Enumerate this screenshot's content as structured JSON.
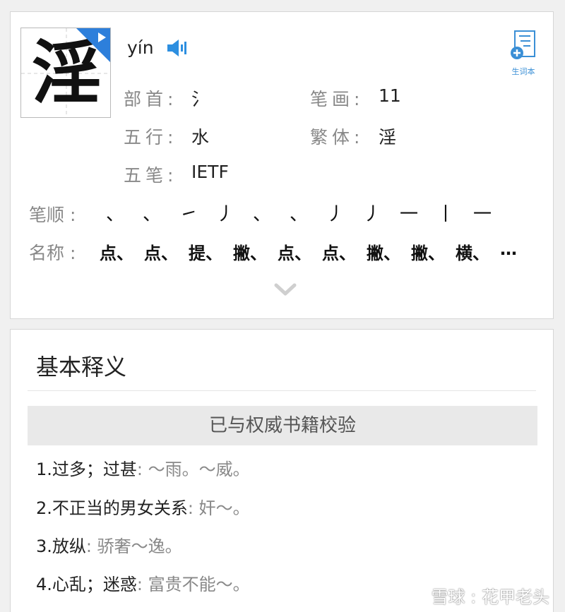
{
  "character": {
    "glyph": "淫",
    "pinyin": "yín",
    "icons": {
      "audio": "speaker-icon",
      "play": "play-icon",
      "vocab": "notebook-add-icon"
    }
  },
  "vocab_button": {
    "label": "生词本"
  },
  "info": {
    "radical_label": "部首:",
    "radical_value": "氵",
    "strokes_label": "笔画:",
    "strokes_value": "11",
    "wuxing_label": "五行:",
    "wuxing_value": "水",
    "traditional_label": "繁体:",
    "traditional_value": "淫",
    "wubi_label": "五笔:",
    "wubi_value": "IETF"
  },
  "stroke_order": {
    "label": "笔顺 :",
    "strokes": [
      "、",
      "、",
      "㇀",
      "丿",
      "、",
      "、",
      "丿",
      "丿",
      "一",
      "丨",
      "一"
    ]
  },
  "stroke_names": {
    "label": "名称 :",
    "names": [
      "点、",
      "点、",
      "提、",
      "撇、",
      "点、",
      "点、",
      "撇、",
      "撇、",
      "横、",
      "…"
    ]
  },
  "basic": {
    "title": "基本释义",
    "verified": "已与权威书籍校验",
    "definitions": [
      {
        "text": "1.过多；过甚",
        "example": ": ～雨。～威。"
      },
      {
        "text": "2.不正当的男女关系",
        "example": ": 奸～。"
      },
      {
        "text": "3.放纵",
        "example": ": 骄奢～逸。"
      },
      {
        "text": "4.心乱；迷惑",
        "example": ": 富贵不能～。"
      }
    ]
  },
  "watermark": {
    "text": "雪球 : 花甲老头"
  },
  "colors": {
    "accent": "#2d7fdb",
    "label_gray": "#888888",
    "icon_blue": "#3a8fd6"
  }
}
